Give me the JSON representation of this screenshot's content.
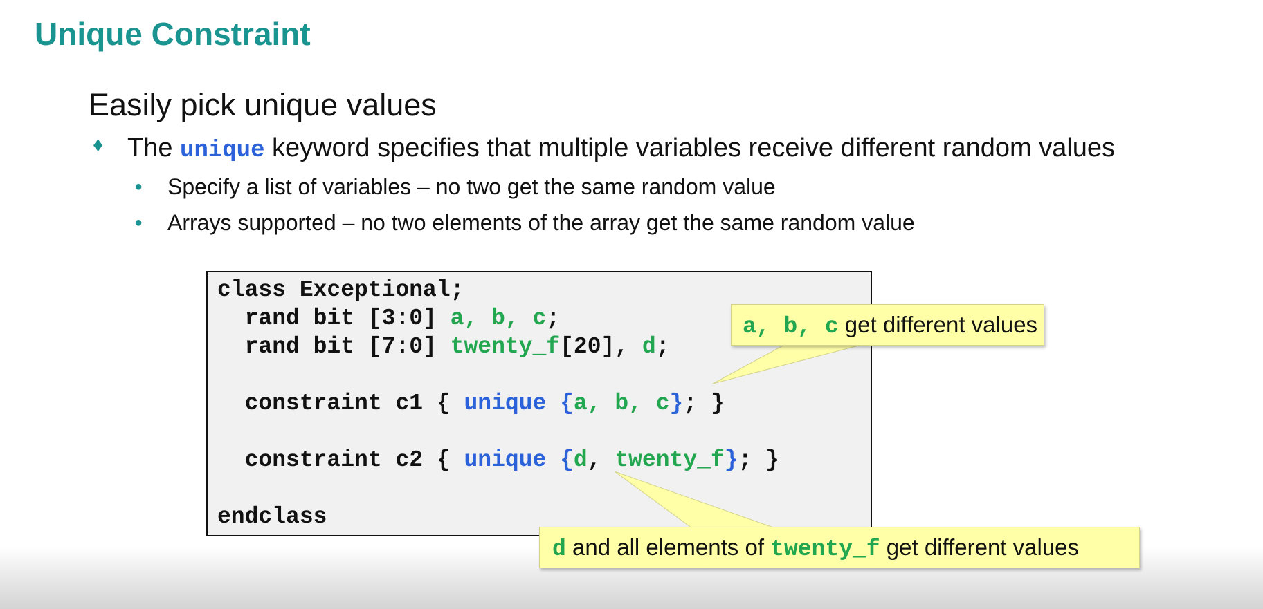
{
  "slide": {
    "title": "Unique Constraint",
    "heading": "Easily pick unique values",
    "bullet": {
      "prefix": "The",
      "keyword": "unique",
      "suffix": "keyword specifies that multiple variables receive different random values"
    },
    "subbullets": [
      "Specify a list of variables – no two get the same random value",
      "Arrays supported – no two elements of the array get the same random value"
    ],
    "code": {
      "l1": "class Exceptional;",
      "l2_pre": "  rand bit [3:0] ",
      "l2_vars": "a, b, c",
      "l2_end": ";",
      "l3_pre": "  rand bit [7:0] ",
      "l3_var1": "twenty_f",
      "l3_mid": "[20], ",
      "l3_var2": "d",
      "l3_end": ";",
      "l4_pre": "  constraint c1 { ",
      "l4_kw": "unique {",
      "l4_vars": "a, b, c",
      "l4_close": "}",
      "l4_end": "; }",
      "l5_pre": "  constraint c2 { ",
      "l5_kw": "unique {",
      "l5_var1": "d",
      "l5_sep": ", ",
      "l5_var2": "twenty_f",
      "l5_close": "}",
      "l5_end": "; }",
      "l6": "endclass"
    },
    "callout1": {
      "vars": "a, b, c",
      "text": "get different values"
    },
    "callout2": {
      "var1": "d",
      "mid": "and all elements of",
      "var2": "twenty_f",
      "text": "get different values"
    },
    "colors": {
      "title": "#1a9490",
      "keyword": "#2b62d9",
      "variable": "#22a650",
      "callout_bg": "#ffffa8"
    }
  }
}
